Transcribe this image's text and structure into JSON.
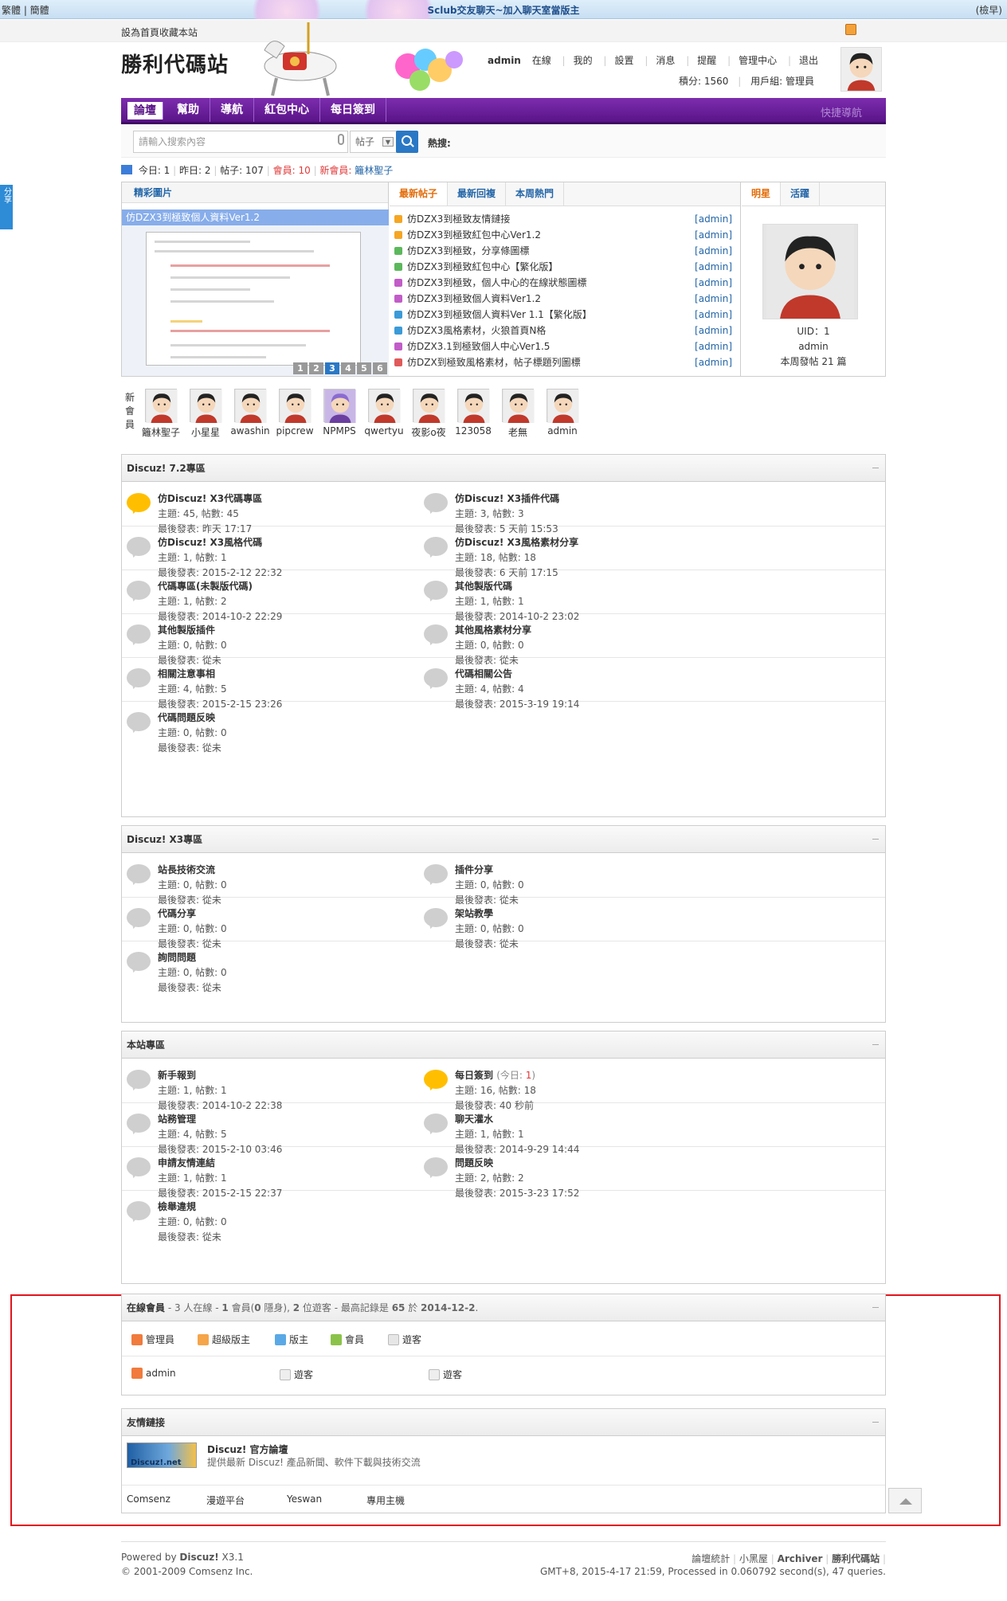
{
  "topbar": {
    "lang": "繁體 | 簡體",
    "promo": "Sclub交友聊天~加入聊天室當版主",
    "hide": "(檢早)"
  },
  "sitebar": {
    "fav": "設為首頁收藏本站"
  },
  "header": {
    "logo": "勝利代碼站",
    "user": "admin",
    "online": "在線",
    "links": [
      "我的",
      "設置",
      "消息",
      "提醒",
      "管理中心",
      "退出"
    ],
    "credits": "積分: 1560",
    "group": "用戶組: 管理員"
  },
  "nav": {
    "items": [
      "論壇",
      "幫助",
      "導航",
      "紅包中心",
      "每日簽到"
    ],
    "quicknav": "快捷導航"
  },
  "search": {
    "placeholder": "請輸入搜索內容",
    "type": "帖子",
    "hot": "熱搜:"
  },
  "stats": {
    "text1": "今日: 1",
    "text2": "昨日: 2",
    "text3": "帖子: 107",
    "members": "會員: 10",
    "newmember_label": "新會員:",
    "newmember": "籬林聖子"
  },
  "portal": {
    "slide_title": "精彩圖片",
    "slide_caption": "仿DZX3到極致個人資料Ver1.2",
    "pager": [
      "1",
      "2",
      "3",
      "4",
      "5",
      "6"
    ],
    "tabs": [
      "最新帖子",
      "最新回複",
      "本周熱門"
    ],
    "threads": [
      {
        "title": "仿DZX3到極致友情鏈接",
        "author": "[admin]",
        "color": "#f5a623"
      },
      {
        "title": "仿DZX3到極致紅包中心Ver1.2",
        "author": "[admin]",
        "color": "#f5a623"
      },
      {
        "title": "仿DZX3到極致，分享條圖標",
        "author": "[admin]",
        "color": "#5cb85c"
      },
      {
        "title": "仿DZX3到極致紅包中心【繁化版】",
        "author": "[admin]",
        "color": "#5cb85c"
      },
      {
        "title": "仿DZX3到極致，個人中心的在線狀態圖標",
        "author": "[admin]",
        "color": "#c25cc8"
      },
      {
        "title": "仿DZX3到極致個人資料Ver1.2",
        "author": "[admin]",
        "color": "#c25cc8"
      },
      {
        "title": "仿DZX3到極致個人資料Ver 1.1【繁化版】",
        "author": "[admin]",
        "color": "#3a9bd8"
      },
      {
        "title": "仿DZX3風格素材，火狼首頁N格",
        "author": "[admin]",
        "color": "#3a9bd8"
      },
      {
        "title": "仿DZX3.1到極致個人中心Ver1.5",
        "author": "[admin]",
        "color": "#c25cc8"
      },
      {
        "title": "仿DZX到極致風格素材，帖子標題列圖標",
        "author": "[admin]",
        "color": "#e05a5a"
      }
    ],
    "star_tabs": [
      "明星",
      "活躍"
    ],
    "star_uid": "UID：1",
    "star_name": "admin",
    "star_posts": "本周發帖 21 篇"
  },
  "newmembers": {
    "label": "新會員",
    "names": [
      "籬林聖子",
      "小星星",
      "awashin",
      "pipcrew",
      "NPMPS",
      "qwertyu",
      "夜影o夜",
      "123058",
      "老無",
      "admin"
    ]
  },
  "cat1": {
    "title": "Discuz! 7.2專區",
    "forums": [
      {
        "name": "仿Discuz! X3代碼專區",
        "stat": "主題: 45, 帖數: 45",
        "last": "最後發表: 昨天 17:17",
        "new": true
      },
      {
        "name": "仿Discuz! X3插件代碼",
        "stat": "主題: 3, 帖數: 3",
        "last": "最後發表: 5 天前 15:53",
        "new": false
      },
      {
        "name": "仿Discuz! X3風格代碼",
        "stat": "主題: 1, 帖數: 1",
        "last": "最後發表: 2015-2-12 22:32",
        "new": false
      },
      {
        "name": "仿Discuz! X3風格素材分享",
        "stat": "主題: 18, 帖數: 18",
        "last": "最後發表: 6 天前 17:15",
        "new": false
      },
      {
        "name": "代碼專區(未製版代碼)",
        "stat": "主題: 1, 帖數: 2",
        "last": "最後發表: 2014-10-2 22:29",
        "new": false
      },
      {
        "name": "其他製版代碼",
        "stat": "主題: 1, 帖數: 1",
        "last": "最後發表: 2014-10-2 23:02",
        "new": false
      },
      {
        "name": "其他製版插件",
        "stat": "主題: 0, 帖數: 0",
        "last": "最後發表: 從未",
        "new": false
      },
      {
        "name": "其他風格素材分享",
        "stat": "主題: 0, 帖數: 0",
        "last": "最後發表: 從未",
        "new": false
      },
      {
        "name": "相關注意事相",
        "stat": "主題: 4, 帖數: 5",
        "last": "最後發表: 2015-2-15 23:26",
        "new": false
      },
      {
        "name": "代碼相關公告",
        "stat": "主題: 4, 帖數: 4",
        "last": "最後發表: 2015-3-19 19:14",
        "new": false
      },
      {
        "name": "代碼問題反映",
        "stat": "主題: 0, 帖數: 0",
        "last": "最後發表: 從未",
        "new": false
      }
    ]
  },
  "cat2": {
    "title": "Discuz! X3專區",
    "forums": [
      {
        "name": "站長技術交流",
        "stat": "主題: 0, 帖數: 0",
        "last": "最後發表: 從未",
        "new": false
      },
      {
        "name": "插件分享",
        "stat": "主題: 0, 帖數: 0",
        "last": "最後發表: 從未",
        "new": false
      },
      {
        "name": "代碼分享",
        "stat": "主題: 0, 帖數: 0",
        "last": "最後發表: 從未",
        "new": false
      },
      {
        "name": "架站教學",
        "stat": "主題: 0, 帖數: 0",
        "last": "最後發表: 從未",
        "new": false
      },
      {
        "name": "詢問問題",
        "stat": "主題: 0, 帖數: 0",
        "last": "最後發表: 從未",
        "new": false
      }
    ]
  },
  "cat3": {
    "title": "本站專區",
    "forums": [
      {
        "name": "新手報到",
        "stat": "主題: 1, 帖數: 1",
        "last": "最後發表: 2014-10-2 22:38",
        "new": false
      },
      {
        "name": "每日簽到",
        "today": "(今日:",
        "today_num": "1",
        "today_end": ")",
        "stat": "主題: 16, 帖數: 18",
        "last": "最後發表: 40 秒前",
        "new": true
      },
      {
        "name": "站務管理",
        "stat": "主題: 4, 帖數: 5",
        "last": "最後發表: 2015-2-10 03:46",
        "new": false
      },
      {
        "name": "聊天灌水",
        "stat": "主題: 1, 帖數: 1",
        "last": "最後發表: 2014-9-29 14:44",
        "new": false
      },
      {
        "name": "申請友情連結",
        "stat": "主題: 1, 帖數: 1",
        "last": "最後發表: 2015-2-15 22:37",
        "new": false
      },
      {
        "name": "問題反映",
        "stat": "主題: 2, 帖數: 2",
        "last": "最後發表: 2015-3-23 17:52",
        "new": false
      },
      {
        "name": "檢舉違規",
        "stat": "主題: 0, 帖數: 0",
        "last": "最後發表: 從未",
        "new": false
      }
    ]
  },
  "online": {
    "title": "在線會員",
    "summary_a": " - 3 人在線 - ",
    "summary_b": "1",
    "summary_c": " 會員(",
    "summary_d": "0",
    "summary_e": " 隱身), ",
    "summary_f": "2",
    "summary_g": " 位遊客 - 最高記錄是 ",
    "summary_h": "65",
    "summary_i": " 於 ",
    "summary_j": "2014-12-2",
    "summary_k": ".",
    "legend": [
      "管理員",
      "超級版主",
      "版主",
      "會員",
      "遊客"
    ],
    "users": [
      "admin",
      "遊客",
      "遊客"
    ]
  },
  "links": {
    "title": "友情鏈接",
    "name": "Discuz! 官方論壇",
    "desc": "提供最新 Discuz! 產品新聞、軟件下載與技術交流",
    "logo": "Discuz!.net",
    "text_links": [
      "Comsenz",
      "漫遊平台",
      "Yeswan",
      "專用主機"
    ]
  },
  "footer": {
    "powered_pre": "Powered by ",
    "powered": "Discuz!",
    "ver": " X3.1",
    "copy": "© 2001-2009 Comsenz Inc.",
    "links": [
      "論壇統計",
      "小黑屋",
      "Archiver",
      "勝利代碼站"
    ],
    "gmt": "GMT+8, 2015-4-17 21:59, Processed in 0.060792 second(s), 47 queries."
  },
  "share": "分享"
}
